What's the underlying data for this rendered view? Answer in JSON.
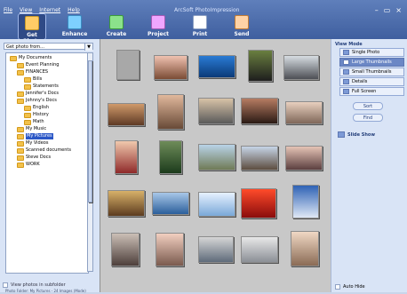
{
  "menu": [
    "File",
    "View",
    "Internet",
    "Help"
  ],
  "app_title": "ArcSoft PhotoImpression",
  "window_controls": [
    "minimize-icon",
    "restore-icon",
    "close-icon"
  ],
  "toolbar": {
    "items": [
      {
        "label": "Get Photo",
        "icon": "get-photo-icon",
        "active": true
      },
      {
        "label": "Enhance",
        "icon": "enhance-icon"
      },
      {
        "label": "Create",
        "icon": "create-icon"
      },
      {
        "label": "Project",
        "icon": "project-icon"
      },
      {
        "label": "Print",
        "icon": "print-icon"
      },
      {
        "label": "Send",
        "icon": "send-icon"
      }
    ]
  },
  "left": {
    "get_photo_from": "Get photo from...",
    "tree": [
      {
        "label": "My Documents",
        "level": 0
      },
      {
        "label": "Event Planning",
        "level": 1
      },
      {
        "label": "FINANCES",
        "level": 1
      },
      {
        "label": "Bills",
        "level": 2
      },
      {
        "label": "Statements",
        "level": 2
      },
      {
        "label": "Jennifer's Docs",
        "level": 1
      },
      {
        "label": "Johnny's Docs",
        "level": 1
      },
      {
        "label": "English",
        "level": 2
      },
      {
        "label": "History",
        "level": 2
      },
      {
        "label": "Math",
        "level": 2
      },
      {
        "label": "My Music",
        "level": 1
      },
      {
        "label": "My Pictures",
        "level": 1,
        "selected": true
      },
      {
        "label": "My Videos",
        "level": 1
      },
      {
        "label": "Scanned documents",
        "level": 1
      },
      {
        "label": "Steve Docs",
        "level": 1
      },
      {
        "label": "WORK",
        "level": 1
      }
    ],
    "view_photos_subfolder": "View photos in subfolder"
  },
  "right": {
    "view_mode_title": "View Mode",
    "view_modes": [
      {
        "label": "Single Photo"
      },
      {
        "label": "Large Thumbnails",
        "active": true
      },
      {
        "label": "Small Thumbnails"
      },
      {
        "label": "Details"
      },
      {
        "label": "Full Screen"
      }
    ],
    "sort_label": "Sort",
    "find_label": "Find",
    "slide_show_label": "Slide Show",
    "auto_hide_label": "Auto Hide"
  },
  "status": "Photo Folder: My Pictures - 24 Images (Mode)",
  "accent_colors": {
    "titlebar": "#4f6fae",
    "panel_bg": "#d9e4f6",
    "gallery_bg": "#c8c8c8",
    "selection": "#2b57c7"
  }
}
